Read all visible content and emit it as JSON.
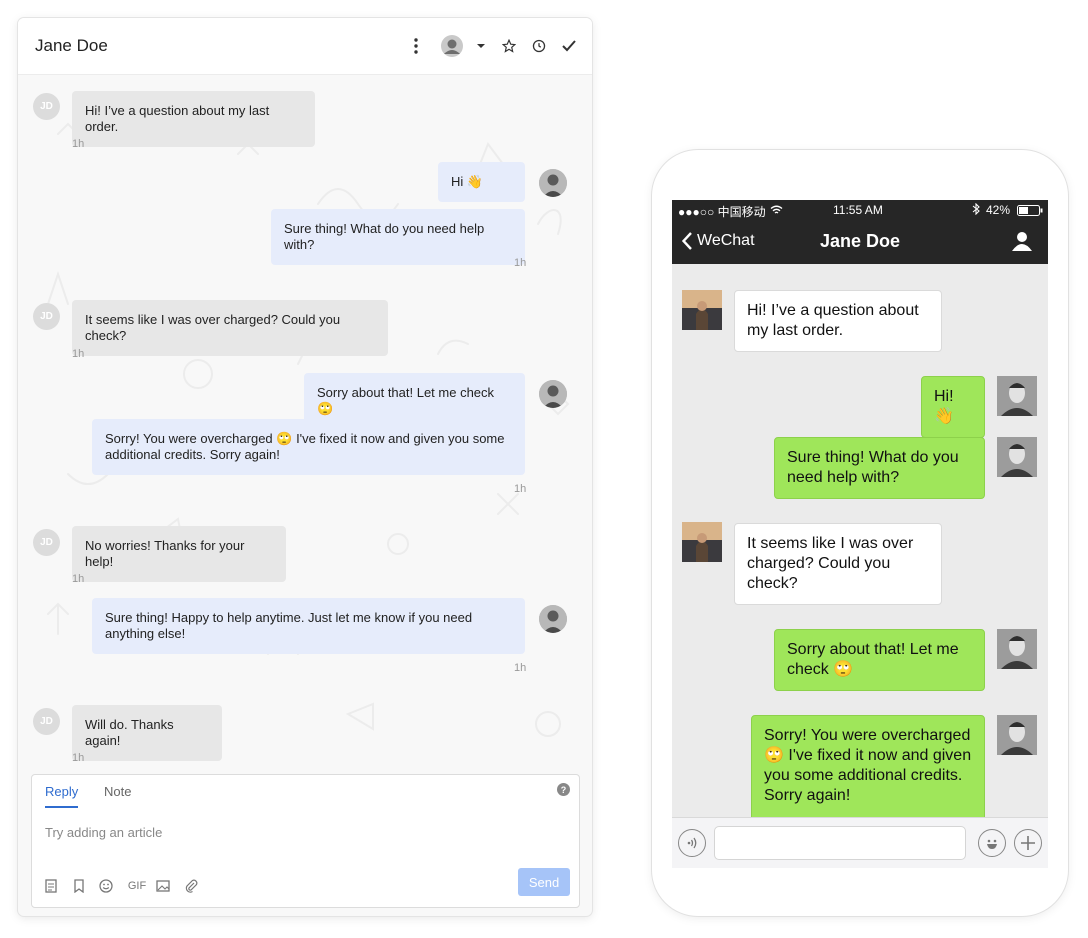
{
  "left": {
    "title": "Jane Doe",
    "user_initials": "JD",
    "messages": [
      {
        "text": "Hi! I’ve a question about my last order.",
        "time": "1h"
      },
      {
        "text": "Hi 👋"
      },
      {
        "text": "Sure thing! What do you need help with?",
        "time": "1h"
      },
      {
        "text": "It seems like I was over charged? Could you check?",
        "time": "1h"
      },
      {
        "text": "Sorry about that! Let me check 🙄"
      },
      {
        "text": "Sorry! You were overcharged 🙄 I've fixed it now and given you some additional credits. Sorry again!",
        "time": "1h"
      },
      {
        "text": "No worries! Thanks for your help!",
        "time": "1h"
      },
      {
        "text": "Sure thing! Happy to help anytime. Just let me know if you need anything else!",
        "time": "1h"
      },
      {
        "text": "Will do. Thanks again!",
        "time": "1h"
      }
    ],
    "composer": {
      "tab_reply": "Reply",
      "tab_note": "Note",
      "placeholder": "Try adding an article",
      "gif_label": "GIF",
      "send_label": "Send",
      "help_label": "?"
    }
  },
  "right": {
    "status": {
      "carrier": "●●●○○ 中国移动",
      "time": "11:55 AM",
      "battery": "42%"
    },
    "nav": {
      "back_label": "WeChat",
      "title": "Jane Doe"
    },
    "messages": [
      {
        "text": "Hi! I’ve a question about my last order."
      },
      {
        "text": "Hi! 👋"
      },
      {
        "text": "Sure thing! What do you need help with?"
      },
      {
        "text": "It seems like I was over charged? Could you check?"
      },
      {
        "text": "Sorry about that! Let me check 🙄"
      },
      {
        "text": "Sorry! You were overcharged 🙄 I've fixed it now and given you some additional credits. Sorry again!"
      }
    ]
  },
  "colors": {
    "accent_blue": "#2f6ccf",
    "outgoing_web": "#e6ecfb",
    "incoming_web": "#e7e7e7",
    "wechat_green": "#9fe65a",
    "wechat_dark": "#262626"
  }
}
